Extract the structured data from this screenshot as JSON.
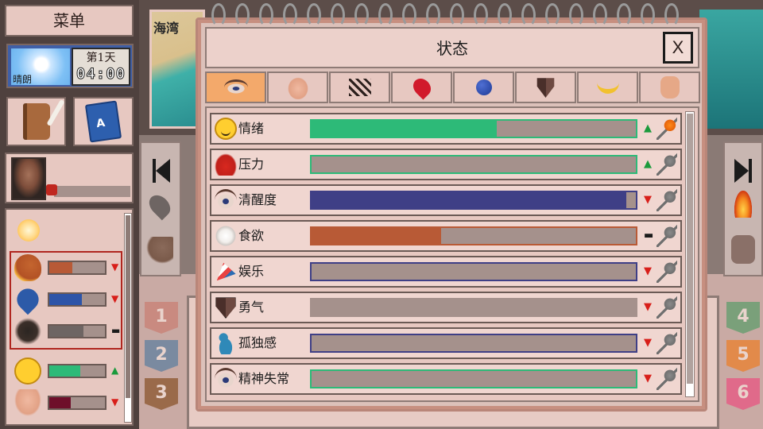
{
  "background": {
    "map_label": "海湾"
  },
  "left_menu": {
    "title": "菜单",
    "weather": {
      "label": "晴朗",
      "day_label": "第1天",
      "time": "04:00"
    },
    "journal_button": {
      "icon": "journal-icon"
    },
    "guide_button": {
      "icon": "guide-book-icon"
    },
    "character": {
      "portrait_icon": "character-portrait",
      "bar_fraction": 0.0
    },
    "needs": [
      {
        "icon": "drumstick-icon",
        "fill": 0.42,
        "color": "#b85a36",
        "trend": "▼"
      },
      {
        "icon": "water-drop-icon",
        "fill": 0.58,
        "color": "#2d54a8",
        "trend": "▼"
      },
      {
        "icon": "dirt-icon",
        "fill": 0.62,
        "color": "#6e6563",
        "trend": "▬"
      },
      {
        "icon": "smiley-icon",
        "fill": 0.55,
        "color": "#2dba78",
        "trend": "▲"
      },
      {
        "icon": "body-icon",
        "fill": 0.38,
        "color": "#6e0f2a",
        "trend": "▼"
      }
    ]
  },
  "side_numbers": {
    "left": [
      "1",
      "2",
      "3"
    ],
    "right": [
      "4",
      "5",
      "6"
    ]
  },
  "status_window": {
    "title": "状态",
    "close_label": "X",
    "tabs": [
      {
        "icon": "eye-icon",
        "active": true
      },
      {
        "icon": "torso-icon",
        "active": false
      },
      {
        "icon": "nerves-icon",
        "active": false
      },
      {
        "icon": "blood-drop-icon",
        "active": false
      },
      {
        "icon": "blue-orb-icon",
        "active": false
      },
      {
        "icon": "shield-icon",
        "active": false
      },
      {
        "icon": "banana-icon",
        "active": false
      },
      {
        "icon": "hand-icon",
        "active": false
      }
    ],
    "stats": [
      {
        "label": "情绪",
        "icon": "smiley-icon",
        "fill": 0.57,
        "fill_color": "#2dba78",
        "border_color": "#2dba78",
        "trend": "▲",
        "trend_type": "up",
        "pinned": true
      },
      {
        "label": "压力",
        "icon": "stressed-person-icon",
        "fill": 0.0,
        "fill_color": "#2dba78",
        "border_color": "#2dba78",
        "trend": "▲",
        "trend_type": "up",
        "pinned": false
      },
      {
        "label": "清醒度",
        "icon": "eye-icon",
        "fill": 0.97,
        "fill_color": "#3f3f86",
        "border_color": "#3f3f86",
        "trend": "▼",
        "trend_type": "down",
        "pinned": false
      },
      {
        "label": "食欲",
        "icon": "plate-icon",
        "fill": 0.4,
        "fill_color": "#b85a36",
        "border_color": "#b85a36",
        "trend": "▬",
        "trend_type": "flat",
        "pinned": false
      },
      {
        "label": "娱乐",
        "icon": "party-popper-icon",
        "fill": 0.0,
        "fill_color": "#3f3f86",
        "border_color": "#3f3f86",
        "trend": "▼",
        "trend_type": "down",
        "pinned": false
      },
      {
        "label": "勇气",
        "icon": "shield-icon",
        "fill": 0.0,
        "fill_color": "#a5918c",
        "border_color": "#a5918c",
        "trend": "▼",
        "trend_type": "down",
        "pinned": false
      },
      {
        "label": "孤独感",
        "icon": "lonely-person-icon",
        "fill": 0.0,
        "fill_color": "#3f3f86",
        "border_color": "#3f3f86",
        "trend": "▼",
        "trend_type": "down",
        "pinned": false
      },
      {
        "label": "精神失常",
        "icon": "eye-icon",
        "fill": 0.0,
        "fill_color": "#2dba78",
        "border_color": "#2dba78",
        "trend": "▼",
        "trend_type": "down",
        "pinned": false
      }
    ]
  }
}
